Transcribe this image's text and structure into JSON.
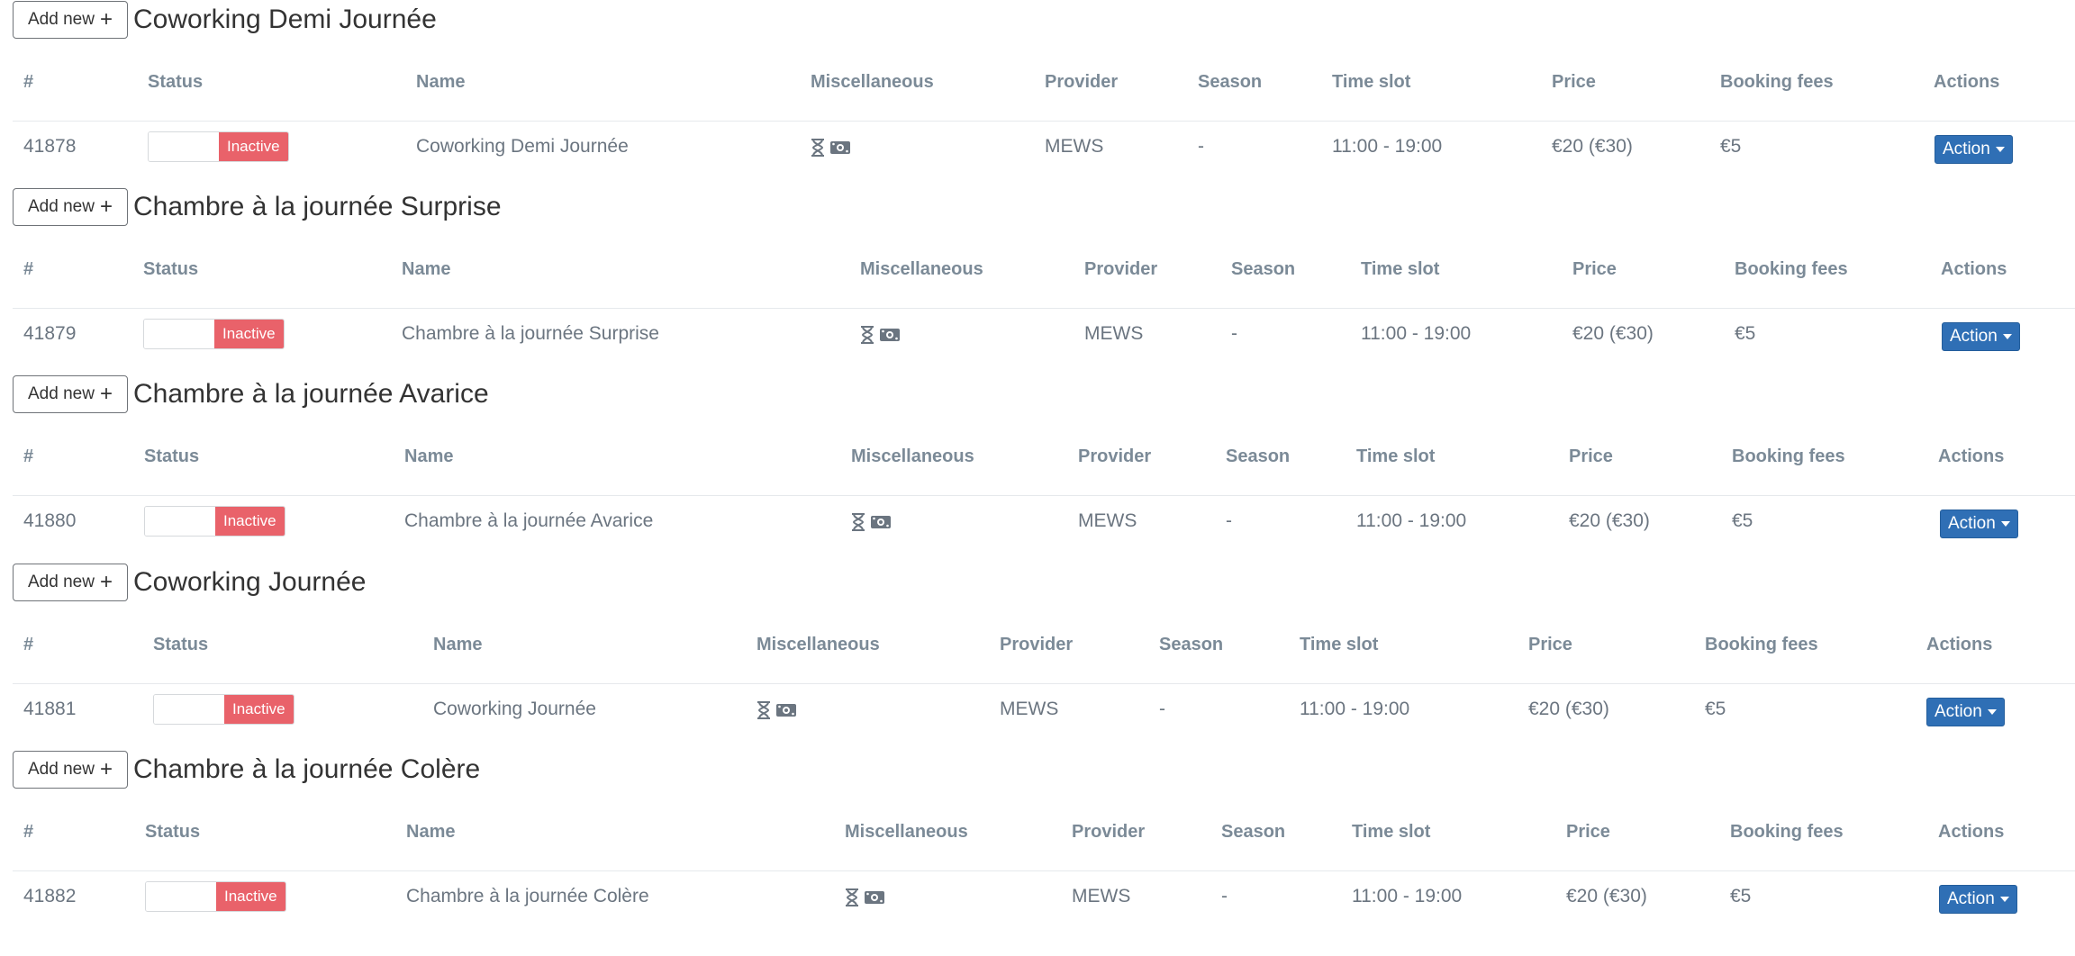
{
  "add_new_label": "Add new",
  "headers": {
    "id": "#",
    "status": "Status",
    "name": "Name",
    "misc": "Miscellaneous",
    "provider": "Provider",
    "season": "Season",
    "timeslot": "Time slot",
    "price": "Price",
    "fees": "Booking fees",
    "actions": "Actions"
  },
  "sections": [
    {
      "title": "Coworking Demi Journée",
      "row": {
        "id": "41878",
        "status": "Inactive",
        "name": "Coworking Demi Journée",
        "provider": "MEWS",
        "season": "-",
        "timeslot": "11:00 - 19:00",
        "price": "€20 (€30)",
        "fees": "€5",
        "action": "Action"
      }
    },
    {
      "title": "Chambre à la journée Surprise",
      "row": {
        "id": "41879",
        "status": "Inactive",
        "name": "Chambre à la journée Surprise",
        "provider": "MEWS",
        "season": "-",
        "timeslot": "11:00 - 19:00",
        "price": "€20 (€30)",
        "fees": "€5",
        "action": "Action"
      }
    },
    {
      "title": "Chambre à la journée Avarice",
      "row": {
        "id": "41880",
        "status": "Inactive",
        "name": "Chambre à la journée Avarice",
        "provider": "MEWS",
        "season": "-",
        "timeslot": "11:00 - 19:00",
        "price": "€20 (€30)",
        "fees": "€5",
        "action": "Action"
      }
    },
    {
      "title": "Coworking Journée",
      "row": {
        "id": "41881",
        "status": "Inactive",
        "name": "Coworking Journée",
        "provider": "MEWS",
        "season": "-",
        "timeslot": "11:00 - 19:00",
        "price": "€20 (€30)",
        "fees": "€5",
        "action": "Action"
      }
    },
    {
      "title": "Chambre à la journée Colère",
      "row": {
        "id": "41882",
        "status": "Inactive",
        "name": "Chambre à la journée Colère",
        "provider": "MEWS",
        "season": "-",
        "timeslot": "11:00 - 19:00",
        "price": "€20 (€30)",
        "fees": "€5",
        "action": "Action"
      }
    }
  ],
  "icons": {
    "misc": [
      "hourglass-icon",
      "money-icon"
    ]
  },
  "colors": {
    "inactive": "#e9626a",
    "action": "#2f6fb5",
    "text": "#6b7580",
    "header": "#7b8a97"
  }
}
